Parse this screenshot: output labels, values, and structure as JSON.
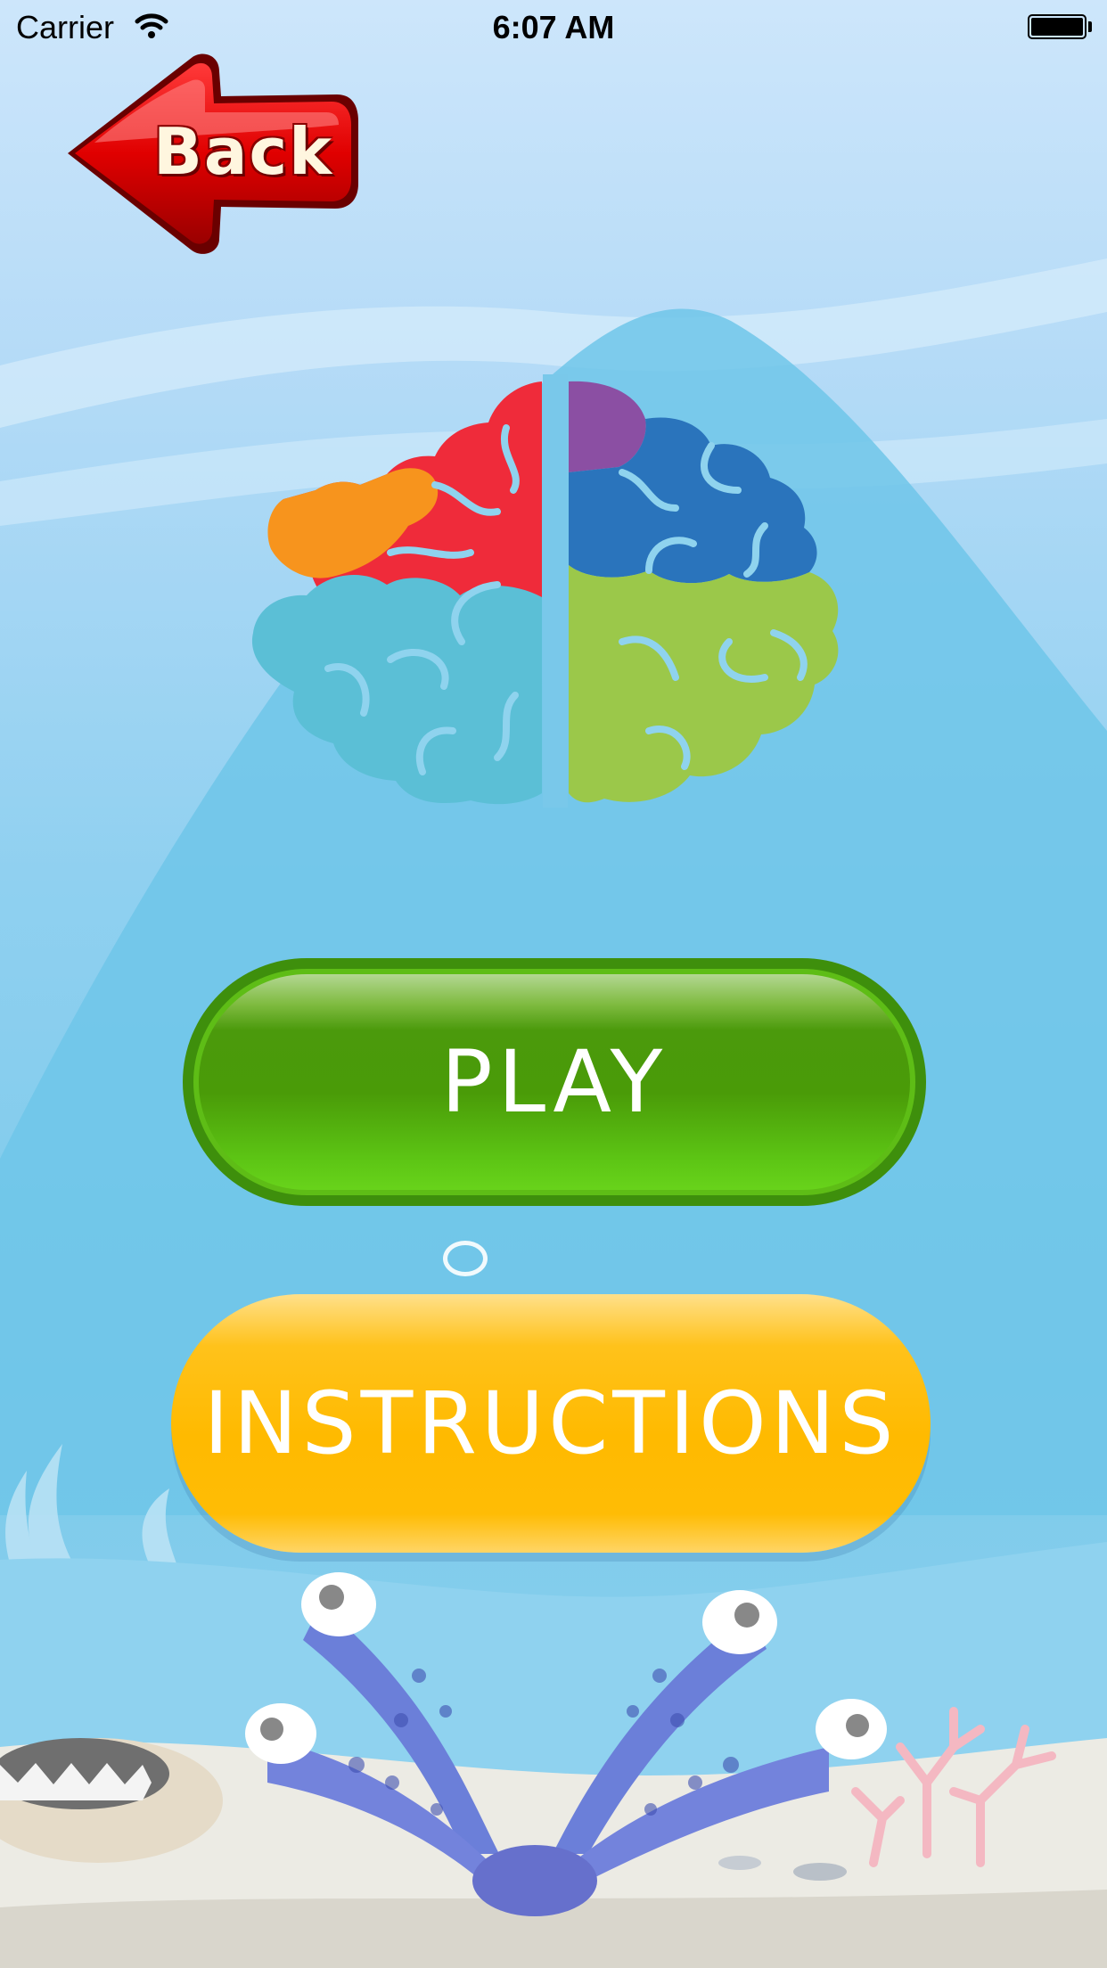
{
  "status_bar": {
    "carrier": "Carrier",
    "time": "6:07 AM",
    "icons": [
      "wifi-icon",
      "battery-icon"
    ]
  },
  "navigation": {
    "back_label": "Back",
    "back_color": "#d40000"
  },
  "logo": {
    "icon": "brain-icon",
    "colors": [
      "#ef2b3a",
      "#f7941d",
      "#8b4fa3",
      "#2a74bc",
      "#5bbfd6",
      "#9bc84a"
    ]
  },
  "menu": {
    "play_label": "PLAY",
    "play_color": "#4a9b08",
    "instructions_label": "INSTRUCTIONS",
    "instructions_color": "#ffba00"
  },
  "background": {
    "theme": "underwater",
    "decorations": [
      "bubble-icon",
      "octopus-icon",
      "clam-icon",
      "coral-icon",
      "seaweed-icon"
    ]
  }
}
